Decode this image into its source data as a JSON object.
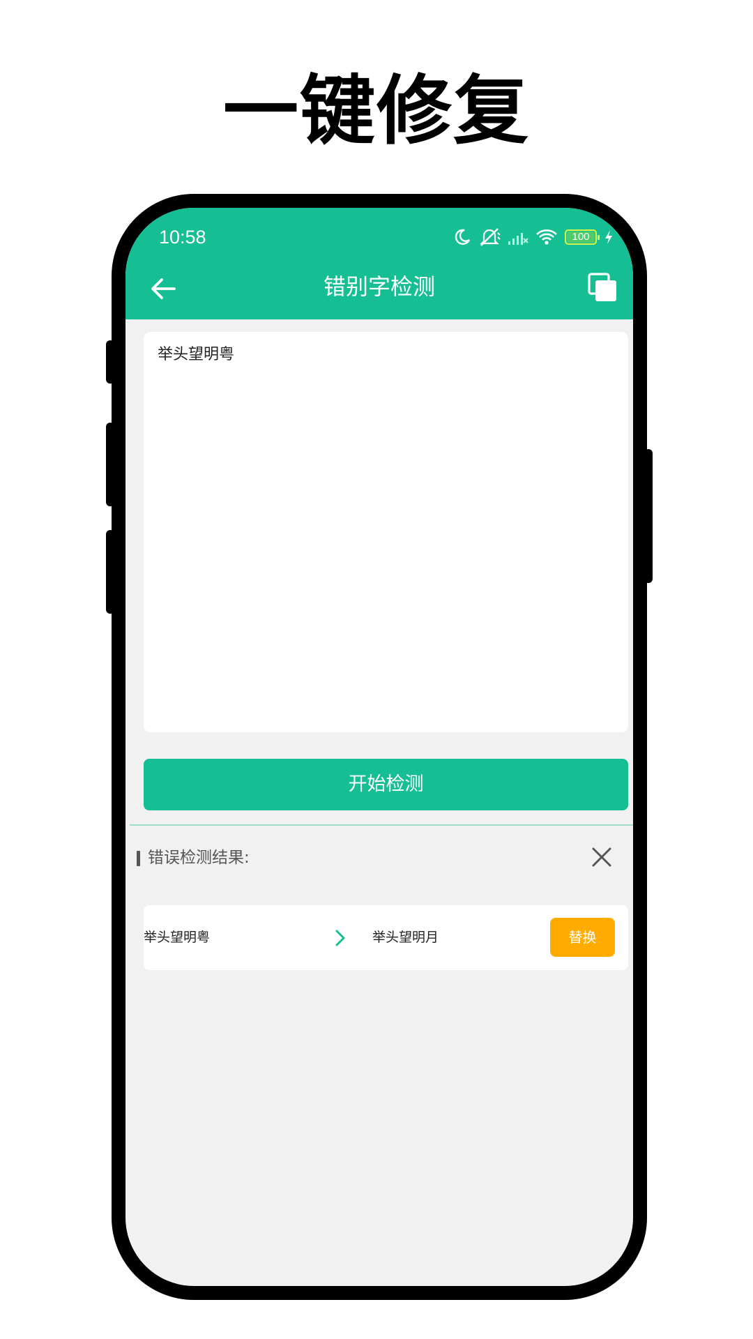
{
  "headline": "一键修复",
  "status_bar": {
    "time": "10:58",
    "battery": "100",
    "icons": [
      "moon-icon",
      "mute-icon",
      "signal-icon",
      "wifi-icon",
      "battery-icon",
      "charging-icon"
    ]
  },
  "app_bar": {
    "title": "错别字检测",
    "back_icon": "arrow-left-icon",
    "action_icon": "copy-icon"
  },
  "editor": {
    "text": "举头望明粤"
  },
  "start_button": {
    "label": "开始检测"
  },
  "results": {
    "title": "错误检测结果:",
    "items": [
      {
        "original": "举头望明粤",
        "corrected": "举头望明月",
        "action_label": "替换"
      }
    ]
  },
  "colors": {
    "primary": "#16be93",
    "accent": "#ffab00",
    "background": "#f1f1f1",
    "card": "#ffffff",
    "text": "#222222"
  }
}
